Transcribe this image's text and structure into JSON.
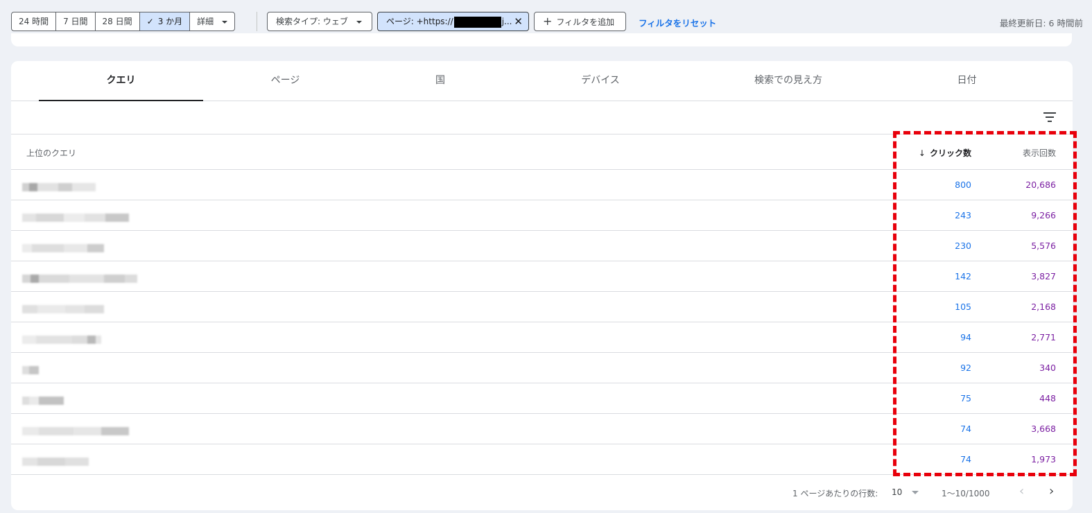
{
  "date_range": {
    "options": [
      "24 時間",
      "7 日間",
      "28 日間",
      "3 か月"
    ],
    "selected": "3 か月",
    "more_label": "詳細"
  },
  "filters": {
    "search_type": "検索タイプ: ウェブ",
    "page_prefix": "ページ: +https://",
    "page_suffix": "j...",
    "add_filter": "フィルタを追加",
    "reset_filters": "フィルタをリセット"
  },
  "last_updated": "最終更新日: 6 時間前",
  "tabs": [
    "クエリ",
    "ページ",
    "国",
    "デバイス",
    "検索での見え方",
    "日付"
  ],
  "active_tab": "クエリ",
  "table": {
    "headers": {
      "query": "上位のクエリ",
      "clicks": "クリック数",
      "impressions": "表示回数"
    },
    "rows": [
      {
        "clicks": "800",
        "impressions": "20,686"
      },
      {
        "clicks": "243",
        "impressions": "9,266"
      },
      {
        "clicks": "230",
        "impressions": "5,576"
      },
      {
        "clicks": "142",
        "impressions": "3,827"
      },
      {
        "clicks": "105",
        "impressions": "2,168"
      },
      {
        "clicks": "94",
        "impressions": "2,771"
      },
      {
        "clicks": "92",
        "impressions": "340"
      },
      {
        "clicks": "75",
        "impressions": "448"
      },
      {
        "clicks": "74",
        "impressions": "3,668"
      },
      {
        "clicks": "74",
        "impressions": "1,973"
      }
    ]
  },
  "pagination": {
    "rows_per_page_label": "1 ページあたりの行数:",
    "rows_per_page": "10",
    "range": "1〜10/1000"
  },
  "colors": {
    "clicks": "#1a73e8",
    "impressions": "#7b1fa2",
    "highlight": "#e8000b",
    "selected_chip": "#d2e3fc"
  }
}
